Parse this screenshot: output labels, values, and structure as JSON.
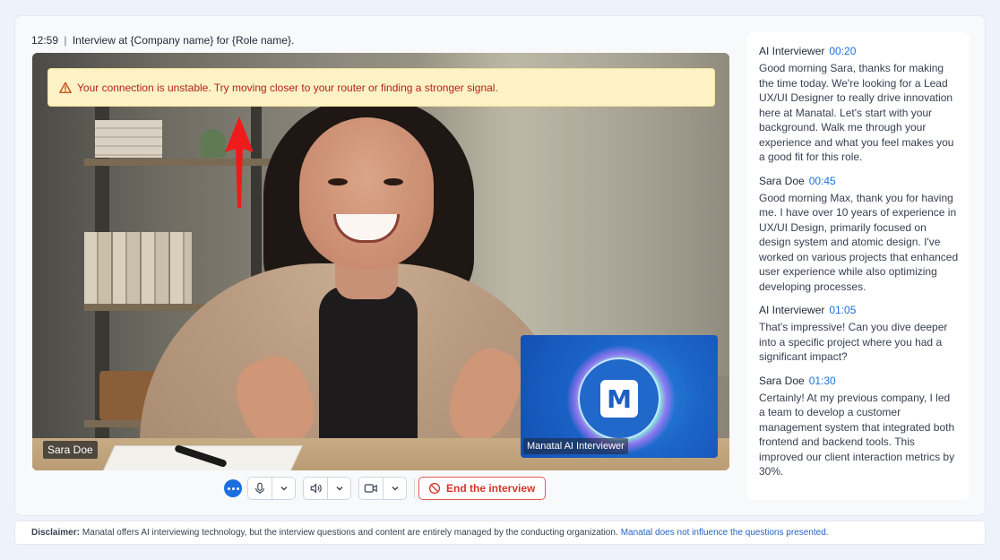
{
  "header": {
    "timer": "12:59",
    "separator": "|",
    "title": "Interview at {Company name} for {Role name}."
  },
  "video": {
    "participant_name": "Sara Doe",
    "ai_name": "Manatal AI Interviewer",
    "ai_logo_letter": "M",
    "alert": {
      "icon": "warning-triangle-icon",
      "message": "Your connection is unstable. Try moving closer to your router or finding a stronger signal.",
      "color": "#b42318",
      "background": "#fdf2c6"
    }
  },
  "controls": {
    "more_icon": "more-dots-icon",
    "mic_icon": "microphone-icon",
    "speaker_icon": "speaker-icon",
    "camera_icon": "camera-icon",
    "chevron_icon": "chevron-down-icon",
    "end_label": "End the interview",
    "end_icon": "prohibit-icon"
  },
  "transcript": [
    {
      "speaker": "AI Interviewer",
      "time": "00:20",
      "text": "Good morning Sara, thanks for making the time today. We're looking for a Lead UX/UI Designer to really drive innovation here at Manatal. Let's start with your background. Walk me through your experience and what you feel makes you a good fit for this role."
    },
    {
      "speaker": "Sara Doe",
      "time": "00:45",
      "text": "Good morning Max, thank you for having me. I have over 10 years of experience in UX/UI Design, primarily focused on design system and atomic design. I've worked on various projects that enhanced user experience while also optimizing developing processes."
    },
    {
      "speaker": "AI Interviewer",
      "time": "01:05",
      "text": "That's impressive! Can you dive deeper into a specific project where you had a significant impact?"
    },
    {
      "speaker": "Sara Doe",
      "time": "01:30",
      "text": "Certainly! At my previous company, I led a team to develop a customer management system that integrated both frontend and backend tools. This improved our client interaction metrics by 30%."
    }
  ],
  "disclaimer": {
    "label": "Disclaimer:",
    "text": "Manatal offers AI interviewing technology, but the interview questions and content are entirely managed by the conducting organization.",
    "link": "Manatal does not influence the questions presented."
  },
  "colors": {
    "accent": "#1d6fe0",
    "danger": "#d6342a"
  }
}
